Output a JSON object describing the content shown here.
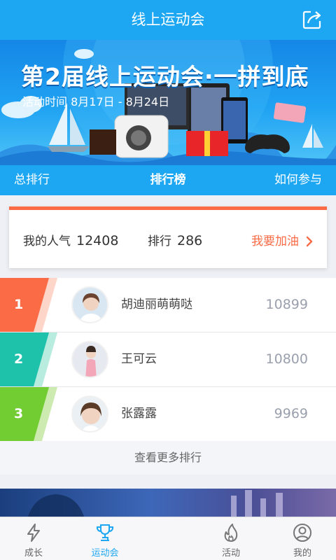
{
  "header": {
    "title": "线上运动会",
    "share_icon": "share-icon"
  },
  "banner": {
    "title": "第2届线上运动会·一拼到底",
    "date": "活动时间 8月17日 - 8月24日"
  },
  "tabs": [
    {
      "label": "总排行"
    },
    {
      "label": "排行榜"
    },
    {
      "label": "如何参与"
    }
  ],
  "my_card": {
    "popularity_label": "我的人气",
    "popularity_value": "12408",
    "rank_label": "排行",
    "rank_value": "286",
    "cheer_label": "我要加油"
  },
  "ranking": [
    {
      "rank": "1",
      "name": "胡迪丽萌萌哒",
      "score": "10899",
      "color": "#fa6b46",
      "stripe": "#fdd5c9"
    },
    {
      "rank": "2",
      "name": "王可云",
      "score": "10800",
      "color": "#1ec1aa",
      "stripe": "#b8ecde"
    },
    {
      "rank": "3",
      "name": "张露露",
      "score": "9969",
      "color": "#72cd32",
      "stripe": "#cdebb0"
    }
  ],
  "more_label": "查看更多排行",
  "nav": [
    {
      "label": "成长",
      "icon": "lightning-icon"
    },
    {
      "label": "运动会",
      "icon": "trophy-icon"
    },
    {
      "label": "活动",
      "icon": "flame-icon"
    },
    {
      "label": "我的",
      "icon": "user-icon"
    }
  ],
  "colors": {
    "primary": "#1da7f2",
    "accent": "#fa6b46"
  }
}
